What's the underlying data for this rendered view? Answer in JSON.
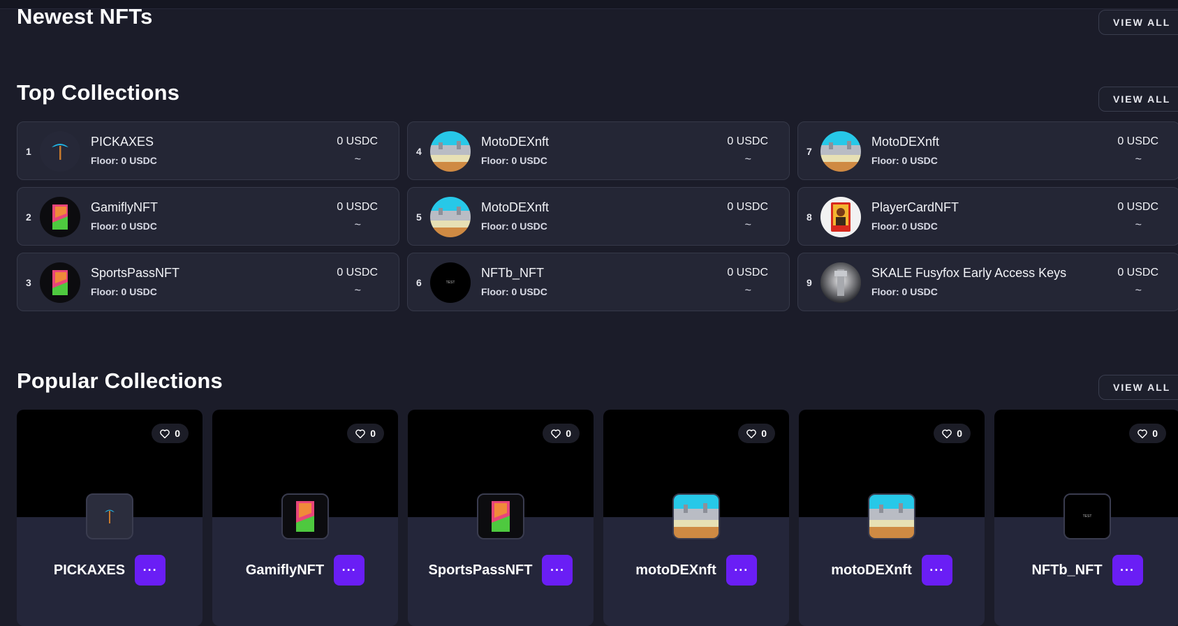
{
  "sections": {
    "newest_title": "Newest NFTs",
    "top_title": "Top Collections",
    "popular_title": "Popular Collections",
    "view_all_label": "VIEW ALL"
  },
  "top_collections": [
    {
      "rank": "1",
      "name": "PICKAXES",
      "floor": "Floor: 0 USDC",
      "price": "0 USDC",
      "change": "~",
      "icon": "pickaxe-icon"
    },
    {
      "rank": "2",
      "name": "GamiflyNFT",
      "floor": "Floor: 0 USDC",
      "price": "0 USDC",
      "change": "~",
      "icon": "card-icon"
    },
    {
      "rank": "3",
      "name": "SportsPassNFT",
      "floor": "Floor: 0 USDC",
      "price": "0 USDC",
      "change": "~",
      "icon": "card-icon"
    },
    {
      "rank": "4",
      "name": "MotoDEXnft",
      "floor": "Floor: 0 USDC",
      "price": "0 USDC",
      "change": "~",
      "icon": "arena-icon"
    },
    {
      "rank": "5",
      "name": "MotoDEXnft",
      "floor": "Floor: 0 USDC",
      "price": "0 USDC",
      "change": "~",
      "icon": "arena-icon"
    },
    {
      "rank": "6",
      "name": "NFTb_NFT",
      "floor": "Floor: 0 USDC",
      "price": "0 USDC",
      "change": "~",
      "icon": "test-icon"
    },
    {
      "rank": "7",
      "name": "MotoDEXnft",
      "floor": "Floor: 0 USDC",
      "price": "0 USDC",
      "change": "~",
      "icon": "arena-icon"
    },
    {
      "rank": "8",
      "name": "PlayerCardNFT",
      "floor": "Floor: 0 USDC",
      "price": "0 USDC",
      "change": "~",
      "icon": "player-icon"
    },
    {
      "rank": "9",
      "name": "SKALE Fusyfox Early Access Keys",
      "floor": "Floor: 0 USDC",
      "price": "0 USDC",
      "change": "~",
      "icon": "key-icon"
    }
  ],
  "popular_collections": [
    {
      "name": "PICKAXES",
      "likes": "0",
      "icon": "pickaxe-icon"
    },
    {
      "name": "GamiflyNFT",
      "likes": "0",
      "icon": "card-icon"
    },
    {
      "name": "SportsPassNFT",
      "likes": "0",
      "icon": "card-icon"
    },
    {
      "name": "motoDEXnft",
      "likes": "0",
      "icon": "arena-icon"
    },
    {
      "name": "motoDEXnft",
      "likes": "0",
      "icon": "arena-icon"
    },
    {
      "name": "NFTb_NFT",
      "likes": "0",
      "icon": "test-icon"
    }
  ],
  "more_label": "···",
  "test_text": "TEST",
  "colors": {
    "background": "#1b1c29",
    "card": "#242635",
    "accent": "#6a1ef5"
  }
}
